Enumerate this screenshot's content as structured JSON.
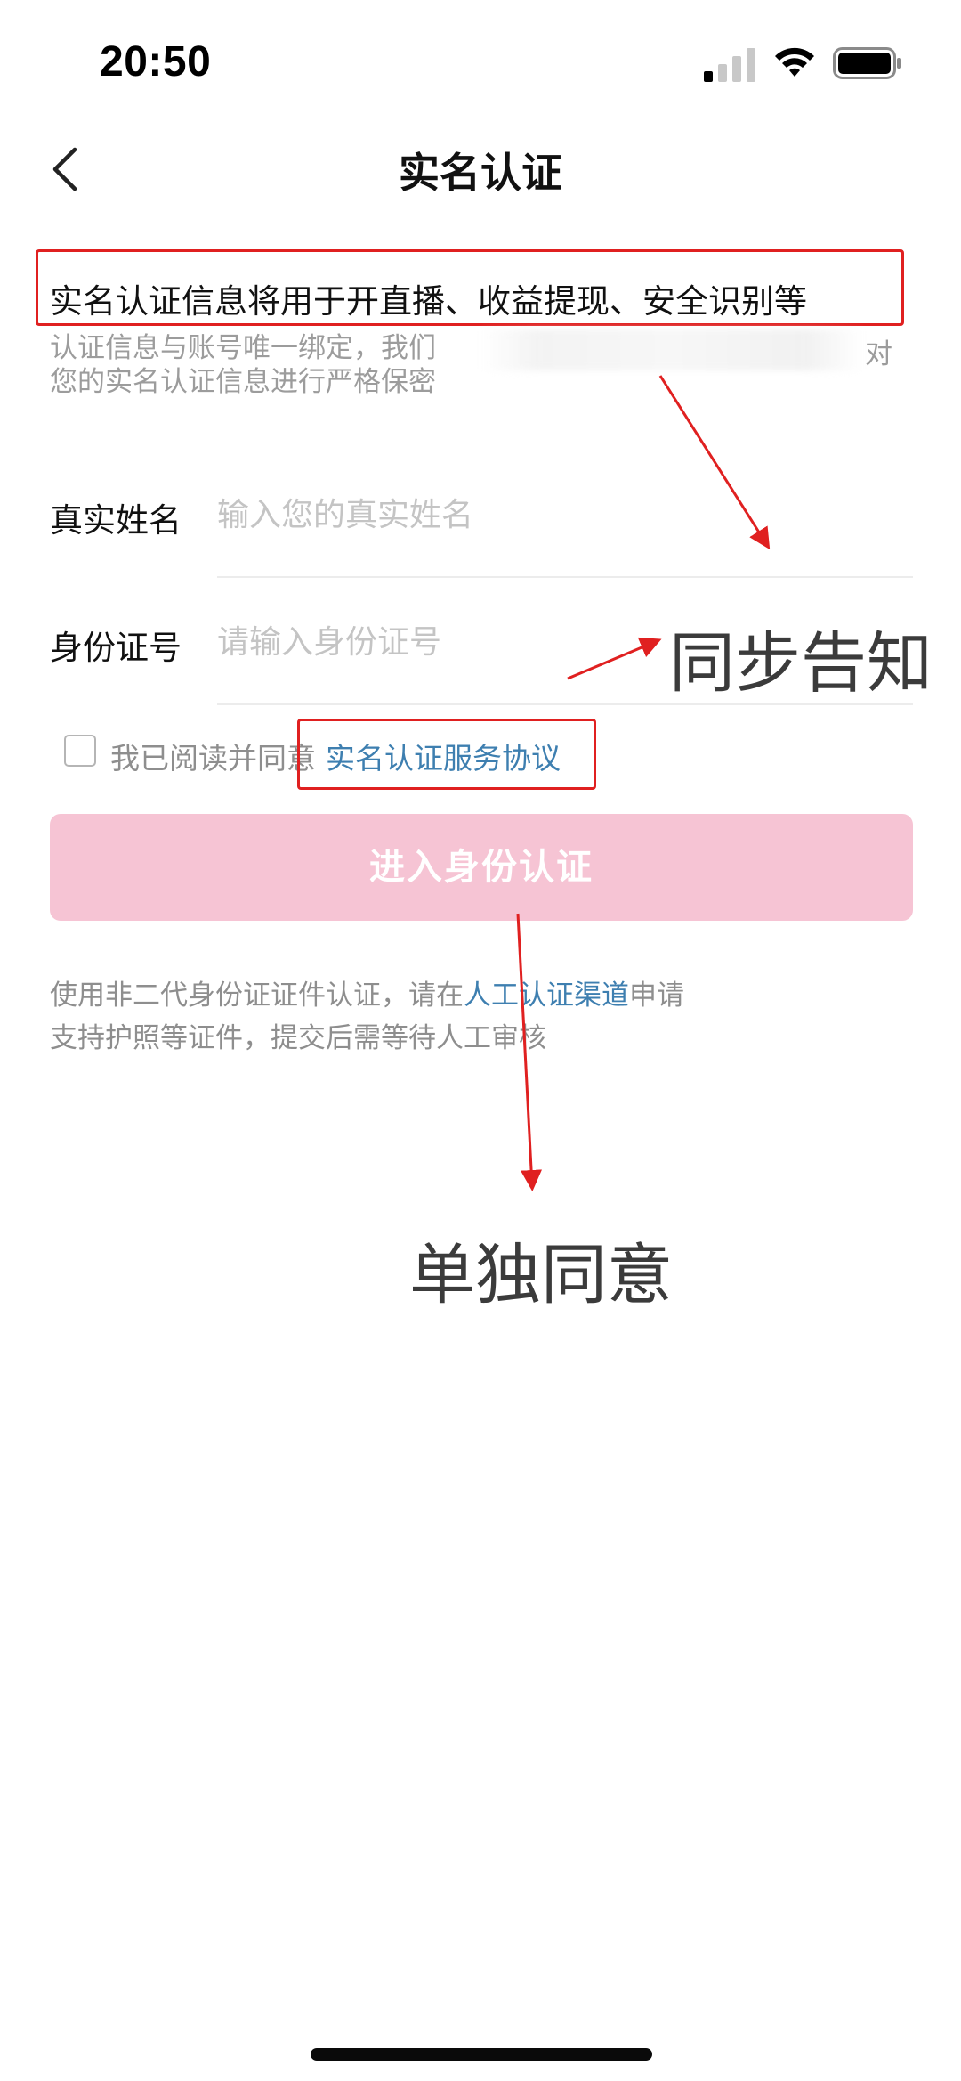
{
  "status_bar": {
    "time": "20:50",
    "signal_icon": "cellular-signal-icon",
    "wifi_icon": "wifi-icon",
    "battery_icon": "battery-icon"
  },
  "nav": {
    "back_icon": "chevron-left-icon",
    "title": "实名认证"
  },
  "intro": {
    "main": "实名认证信息将用于开直播、收益提现、安全识别等",
    "sub_line1": "认证信息与账号唯一绑定，我们",
    "sub_line1_end": "对",
    "sub_line2": "您的实名认证信息进行严格保密"
  },
  "form": {
    "name_label": "真实姓名",
    "name_placeholder": "输入您的真实姓名",
    "name_value": "",
    "id_label": "身份证号",
    "id_placeholder": "请输入身份证号",
    "id_value": ""
  },
  "agreement": {
    "checked": false,
    "text": "我已阅读并同意",
    "link": "实名认证服务协议"
  },
  "submit": {
    "label": "进入身份认证"
  },
  "note": {
    "line1_pre": "使用非二代身份证证件认证，请在",
    "line1_link": "人工认证渠道",
    "line1_post": "申请",
    "line2": "支持护照等证件，提交后需等待人工审核"
  },
  "annotations": {
    "sync_notice": "同步告知",
    "separate_consent": "单独同意"
  },
  "colors": {
    "accent_link": "#3e7fb0",
    "button_disabled": "#f6c4d4",
    "annotation_red": "#e02020"
  }
}
